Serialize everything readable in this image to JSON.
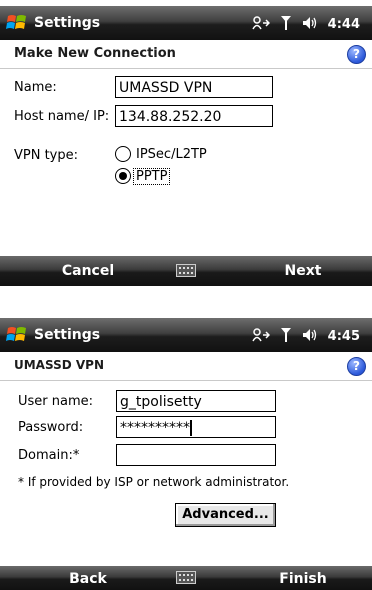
{
  "screen1": {
    "titlebar": {
      "title": "Settings",
      "time": "4:44"
    },
    "header": {
      "title": "Make New Connection",
      "help": "?"
    },
    "form": {
      "name_label": "Name:",
      "name_value": "UMASSD VPN",
      "host_label": "Host name/ IP:",
      "host_value": "134.88.252.20",
      "vpn_type_label": "VPN type:",
      "vpn_options": [
        "IPSec/L2TP",
        "PPTP"
      ],
      "vpn_selected": "PPTP"
    },
    "softkeys": {
      "left": "Cancel",
      "right": "Next"
    }
  },
  "screen2": {
    "titlebar": {
      "title": "Settings",
      "time": "4:45"
    },
    "header": {
      "title": "UMASSD VPN",
      "help": "?"
    },
    "form": {
      "user_label": "User name:",
      "user_value": "g_tpolisetty",
      "password_label": "Password:",
      "password_value": "**********",
      "domain_label": "Domain:*",
      "domain_value": "",
      "note": "* If provided by ISP or network administrator.",
      "advanced_label": "Advanced..."
    },
    "softkeys": {
      "left": "Back",
      "right": "Finish"
    }
  },
  "icons": [
    "windows-logo-icon",
    "connectivity-icon",
    "signal-icon",
    "volume-icon",
    "help-icon",
    "keyboard-icon"
  ]
}
